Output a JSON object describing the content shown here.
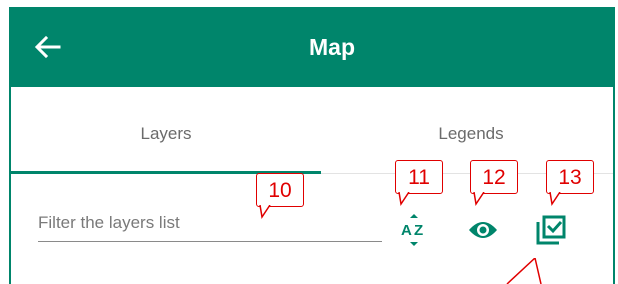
{
  "header": {
    "title": "Map",
    "back_icon": "arrow-left-icon",
    "background_color": "#00856b"
  },
  "tabs": [
    {
      "label": "Layers",
      "active": true
    },
    {
      "label": "Legends",
      "active": false
    }
  ],
  "filter": {
    "placeholder": "Filter the layers list",
    "value": ""
  },
  "toolbar": [
    {
      "icon": "sort-alpha-icon"
    },
    {
      "icon": "eye-icon"
    },
    {
      "icon": "select-all-icon"
    }
  ],
  "annotations": [
    {
      "label": "10"
    },
    {
      "label": "11"
    },
    {
      "label": "12"
    },
    {
      "label": "13"
    }
  ],
  "colors": {
    "accent": "#00856b",
    "annotation": "#e00000",
    "tab_text": "#6b6b6b"
  }
}
